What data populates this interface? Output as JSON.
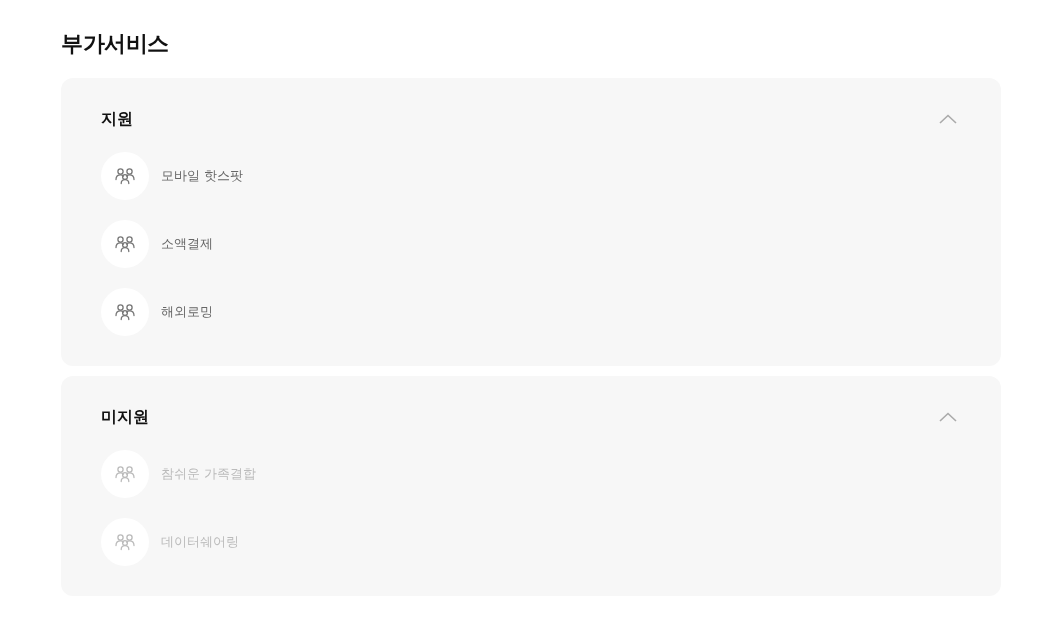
{
  "page": {
    "title": "부가서비스"
  },
  "sections": [
    {
      "title": "지원",
      "expanded": true,
      "items": [
        {
          "label": "모바일 핫스팟",
          "disabled": false
        },
        {
          "label": "소액결제",
          "disabled": false
        },
        {
          "label": "해외로밍",
          "disabled": false
        }
      ]
    },
    {
      "title": "미지원",
      "expanded": true,
      "items": [
        {
          "label": "참쉬운 가족결합",
          "disabled": true
        },
        {
          "label": "데이터쉐어링",
          "disabled": true
        }
      ]
    }
  ]
}
